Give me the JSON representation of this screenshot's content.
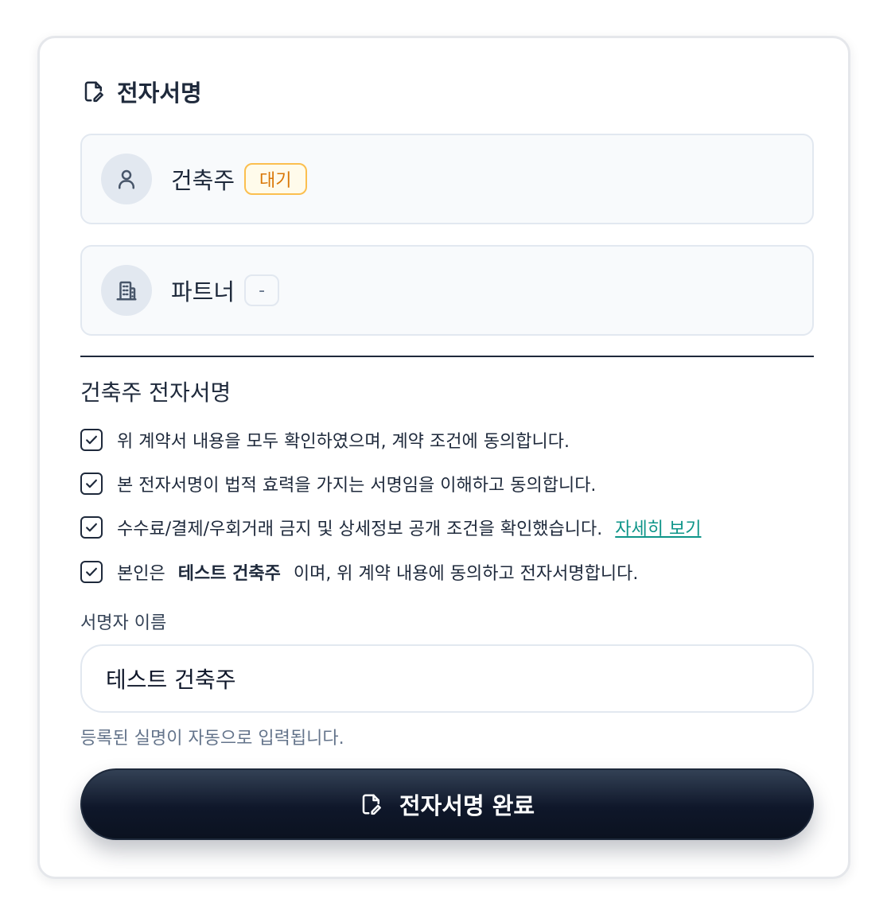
{
  "card": {
    "title": "전자서명",
    "title_icon": "signature-doc-icon"
  },
  "parties": [
    {
      "name": "건축주",
      "status": "대기",
      "icon": "user-icon",
      "status_color": "#d97706"
    },
    {
      "name": "파트너",
      "status": "-",
      "icon": "building-icon"
    }
  ],
  "signature_section": {
    "title": "건축주 전자서명",
    "agreements": [
      {
        "text": "위 계약서 내용을 모두 확인하였으며, 계약 조건에 동의합니다.",
        "checked": true
      },
      {
        "text": "본 전자서명이 법적 효력을 가지는 서명임을 이해하고 동의합니다.",
        "checked": true
      },
      {
        "text": "수수료/결제/우회거래 금지 및 상세정보 공개 조건을 확인했습니다.",
        "link": "자세히 보기",
        "checked": true
      },
      {
        "prefix": "본인은",
        "name": "테스트 건축주",
        "suffix": "이며, 위 계약 내용에 동의하고 전자서명합니다.",
        "checked": true
      }
    ],
    "signer_label": "서명자 이름",
    "signer_value": "테스트 건축주",
    "hint": "등록된 실명이 자동으로 입력됩니다.",
    "submit_label": "전자서명 완료",
    "submit_icon": "signature-doc-icon"
  },
  "colors": {
    "accent_link": "#0d9488",
    "button_bg": "#0f172a",
    "waiting_badge": "#fbbf4f"
  }
}
